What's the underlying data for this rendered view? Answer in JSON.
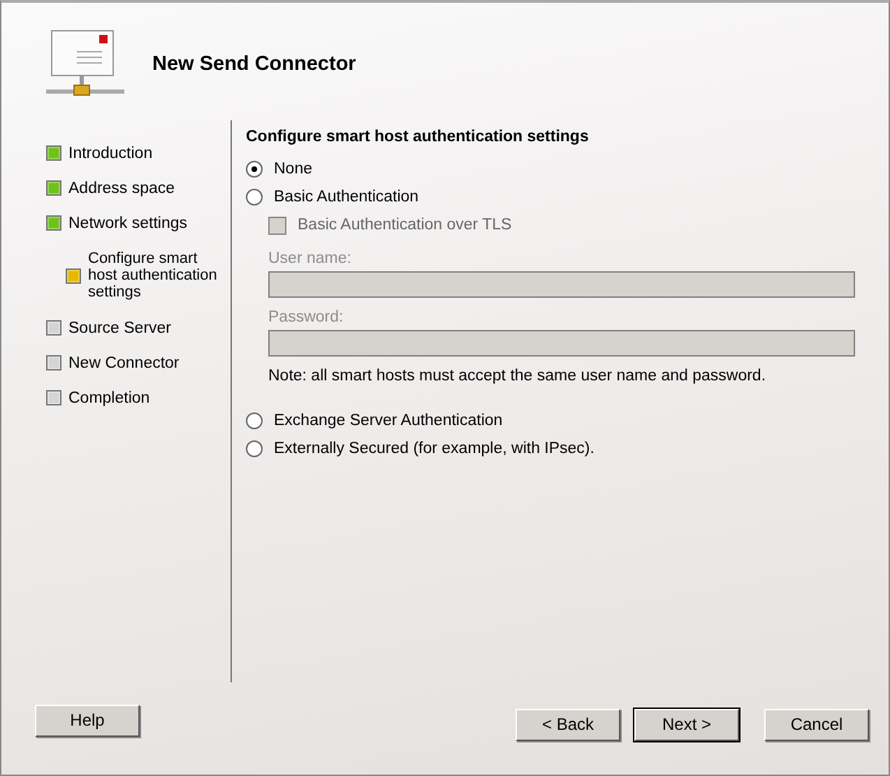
{
  "window": {
    "title": "New Send Connector"
  },
  "steps": [
    {
      "label": "Introduction",
      "color": "#6fc21a"
    },
    {
      "label": "Address space",
      "color": "#6fc21a"
    },
    {
      "label": "Network settings",
      "color": "#6fc21a",
      "children": [
        {
          "label": "Configure smart host authentication settings",
          "color": "#e8b800"
        }
      ]
    },
    {
      "label": "Source Server",
      "color": "#d4d4d4"
    },
    {
      "label": "New Connector",
      "color": "#d4d4d4"
    },
    {
      "label": "Completion",
      "color": "#d4d4d4"
    }
  ],
  "page": {
    "heading": "Configure smart host authentication settings",
    "options": [
      {
        "kind": "radio",
        "label": "None",
        "selected": true
      },
      {
        "kind": "radio",
        "label": "Basic Authentication",
        "selected": false
      },
      {
        "kind": "checkbox",
        "label": "Basic Authentication over TLS",
        "checked": false,
        "disabled": true
      },
      {
        "kind": "field",
        "label": "User name:",
        "disabled": true
      },
      {
        "kind": "field",
        "label": "Password:",
        "disabled": true
      },
      {
        "kind": "note",
        "label": "Note: all smart hosts must accept the same user name and password."
      },
      {
        "kind": "radio",
        "label": "Exchange Server Authentication",
        "selected": false
      },
      {
        "kind": "radio",
        "label": "Externally Secured (for example, with IPsec).",
        "selected": false
      }
    ]
  },
  "buttons": {
    "help": "Help",
    "back": "< Back",
    "next": "Next >",
    "cancel": "Cancel"
  }
}
